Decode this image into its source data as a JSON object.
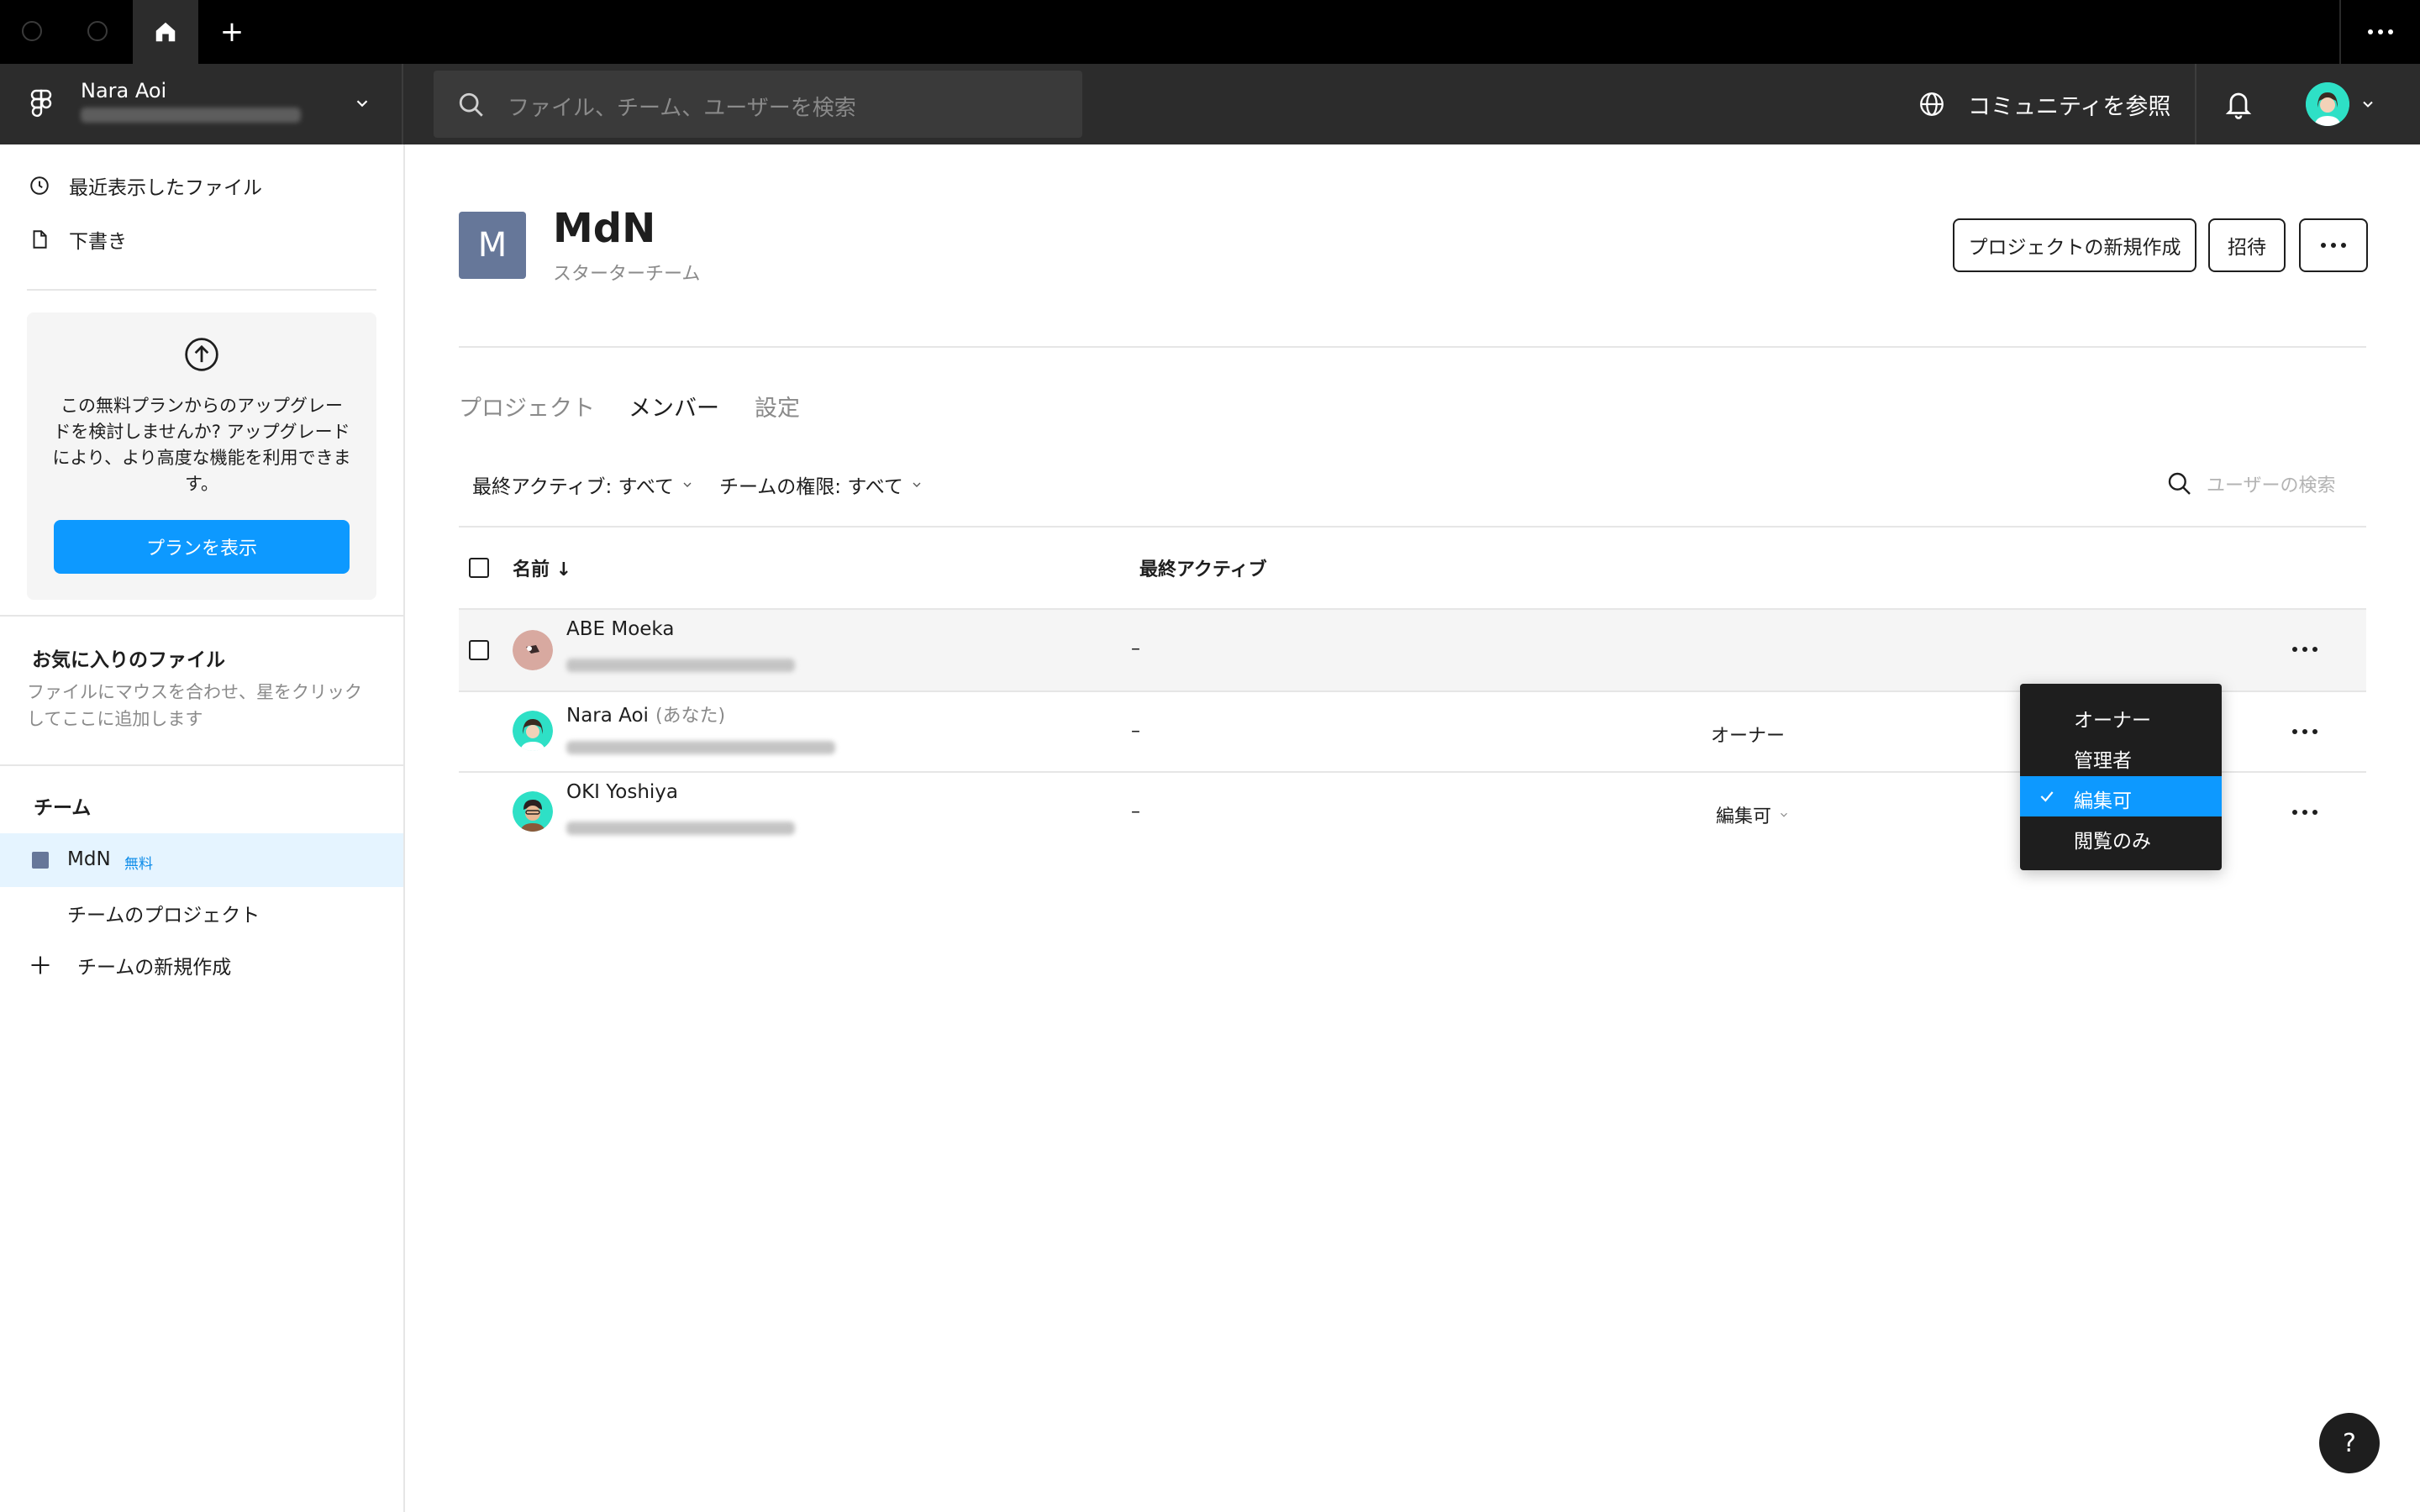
{
  "tabbar": {
    "new_tab_label": "+"
  },
  "header": {
    "account_name": "Nara Aoi",
    "search_placeholder": "ファイル、チーム、ユーザーを検索",
    "community_label": "コミュニティを参照"
  },
  "sidebar": {
    "recent_label": "最近表示したファイル",
    "drafts_label": "下書き",
    "upgrade_text": "この無料プランからのアップグレードを検討しませんか? アップグレードにより、より高度な機能を利用できます。",
    "upgrade_button": "プランを表示",
    "favorites_title": "お気に入りのファイル",
    "favorites_desc": "ファイルにマウスを合わせ、星をクリックしてここに追加します",
    "teams_title": "チーム",
    "team_name": "MdN",
    "team_badge": "無料",
    "team_projects": "チームのプロジェクト",
    "new_team": "チームの新規作成"
  },
  "team": {
    "initial": "M",
    "name": "MdN",
    "plan": "スターターチーム",
    "new_project_button": "プロジェクトの新規作成",
    "invite_button": "招待"
  },
  "tabs": {
    "projects": "プロジェクト",
    "members": "メンバー",
    "settings": "設定"
  },
  "filters": {
    "last_active": "最終アクティブ: すべて",
    "permission": "チームの権限: すべて",
    "user_search_placeholder": "ユーザーの検索"
  },
  "table": {
    "col_name": "名前 ↓",
    "col_last_active": "最終アクティブ"
  },
  "members": [
    {
      "name": "ABE Moeka",
      "you": "",
      "last_active": "–",
      "role": ""
    },
    {
      "name": "Nara Aoi",
      "you": "(あなた)",
      "last_active": "–",
      "role": "オーナー"
    },
    {
      "name": "OKI Yoshiya",
      "you": "",
      "last_active": "–",
      "role": "編集可"
    }
  ],
  "role_dropdown": {
    "options": [
      "オーナー",
      "管理者",
      "編集可",
      "閲覧のみ"
    ],
    "selected": "編集可"
  },
  "help_label": "?",
  "colors": {
    "accent": "#0d99ff",
    "team": "#667799",
    "header_bg": "#2c2c2c"
  }
}
